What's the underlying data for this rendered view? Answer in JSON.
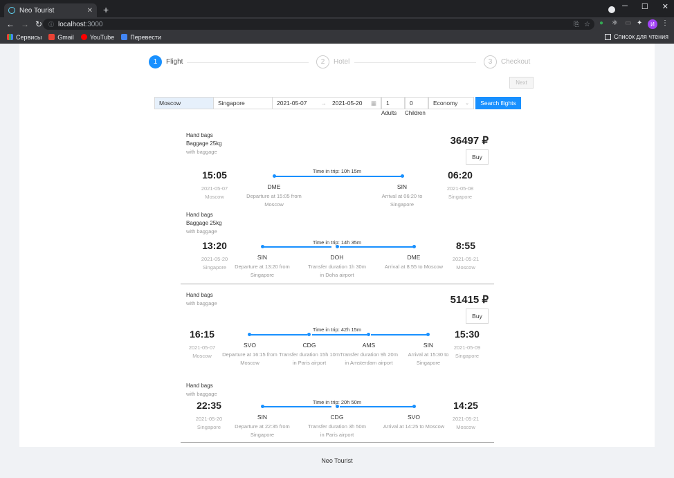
{
  "browser": {
    "tab_title": "Neo Tourist",
    "url_host": "localhost",
    "url_port": ":3000",
    "bookmarks": [
      "Сервисы",
      "Gmail",
      "YouTube",
      "Перевести"
    ],
    "reading_list": "Список для чтения",
    "avatar_letter": "И"
  },
  "steps": [
    {
      "num": "1",
      "label": "Flight"
    },
    {
      "num": "2",
      "label": "Hotel"
    },
    {
      "num": "3",
      "label": "Checkout"
    }
  ],
  "next_label": "Next",
  "search": {
    "from": "Moscow",
    "to": "Singapore",
    "date_from": "2021-05-07",
    "date_to": "2021-05-20",
    "adults": "1",
    "children": "0",
    "cabin": "Economy",
    "button": "Search flights",
    "adults_label": "Adults",
    "children_label": "Children"
  },
  "buy_label": "Buy",
  "offers": [
    {
      "price": "36497 ₽",
      "legs": [
        {
          "bags": [
            "Hand bags",
            "Baggage 25kg"
          ],
          "note": "with baggage",
          "dep_time": "15:05",
          "dep_date": "2021-05-07",
          "dep_city": "Moscow",
          "arr_time": "06:20",
          "arr_date": "2021-05-08",
          "arr_city": "Singapore",
          "duration": "Time in trip: 10h 15m",
          "stops": [
            {
              "code": "DME",
              "text": "Departure at 15:05 from Moscow"
            },
            {
              "code": "SIN",
              "text": "Arrival at 06:20 to Singapore"
            }
          ]
        },
        {
          "bags": [
            "Hand bags",
            "Baggage 25kg"
          ],
          "note": "with baggage",
          "dep_time": "13:20",
          "dep_date": "2021-05-20",
          "dep_city": "Singapore",
          "arr_time": "8:55",
          "arr_date": "2021-05-21",
          "arr_city": "Moscow",
          "duration": "Time in trip: 14h 35m",
          "stops": [
            {
              "code": "SIN",
              "text": "Departure at 13:20 from Singapore"
            },
            {
              "code": "DOH",
              "text": "Transfer duration 1h 30m in Doha airport"
            },
            {
              "code": "DME",
              "text": "Arrival at 8:55 to Moscow"
            }
          ]
        }
      ]
    },
    {
      "price": "51415 ₽",
      "legs": [
        {
          "bags": [
            "Hand bags"
          ],
          "note": "with baggage",
          "dep_time": "16:15",
          "dep_date": "2021-05-07",
          "dep_city": "Moscow",
          "arr_time": "15:30",
          "arr_date": "2021-05-09",
          "arr_city": "Singapore",
          "duration": "Time in trip: 42h 15m",
          "stops": [
            {
              "code": "SVO",
              "text": "Departure at 16:15 from Moscow"
            },
            {
              "code": "CDG",
              "text": "Transfer duration 15h 10m in Paris airport"
            },
            {
              "code": "AMS",
              "text": "Transfer duration 9h 20m in Amsterdam airport"
            },
            {
              "code": "SIN",
              "text": "Arrival at 15:30 to Singapore"
            }
          ]
        },
        {
          "bags": [
            "Hand bags"
          ],
          "note": "with baggage",
          "dep_time": "22:35",
          "dep_date": "2021-05-20",
          "dep_city": "Singapore",
          "arr_time": "14:25",
          "arr_date": "2021-05-21",
          "arr_city": "Moscow",
          "duration": "Time in trip: 20h 50m",
          "stops": [
            {
              "code": "SIN",
              "text": "Departure at 22:35 from Singapore"
            },
            {
              "code": "CDG",
              "text": "Transfer duration 3h 50m in Paris airport"
            },
            {
              "code": "SVO",
              "text": "Arrival at 14:25 to Moscow"
            }
          ]
        }
      ]
    }
  ],
  "footer": "Neo Tourist"
}
